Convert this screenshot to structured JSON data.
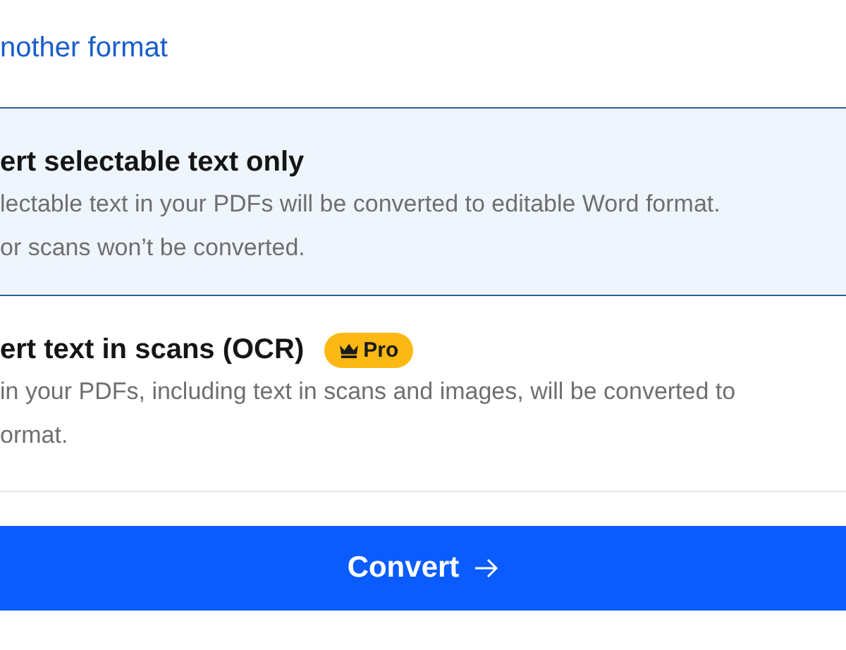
{
  "link": {
    "label": "nother format"
  },
  "options": [
    {
      "title": "ert selectable text only",
      "selected": true,
      "description": [
        "lectable text in your PDFs will be converted to editable Word format.",
        "or scans won’t be converted."
      ]
    },
    {
      "title": "ert text in scans (OCR)",
      "badge": "Pro",
      "selected": false,
      "description": [
        "in your PDFs, including text in scans and images, will be converted to",
        "ormat."
      ]
    }
  ],
  "button": {
    "label": "Convert"
  }
}
